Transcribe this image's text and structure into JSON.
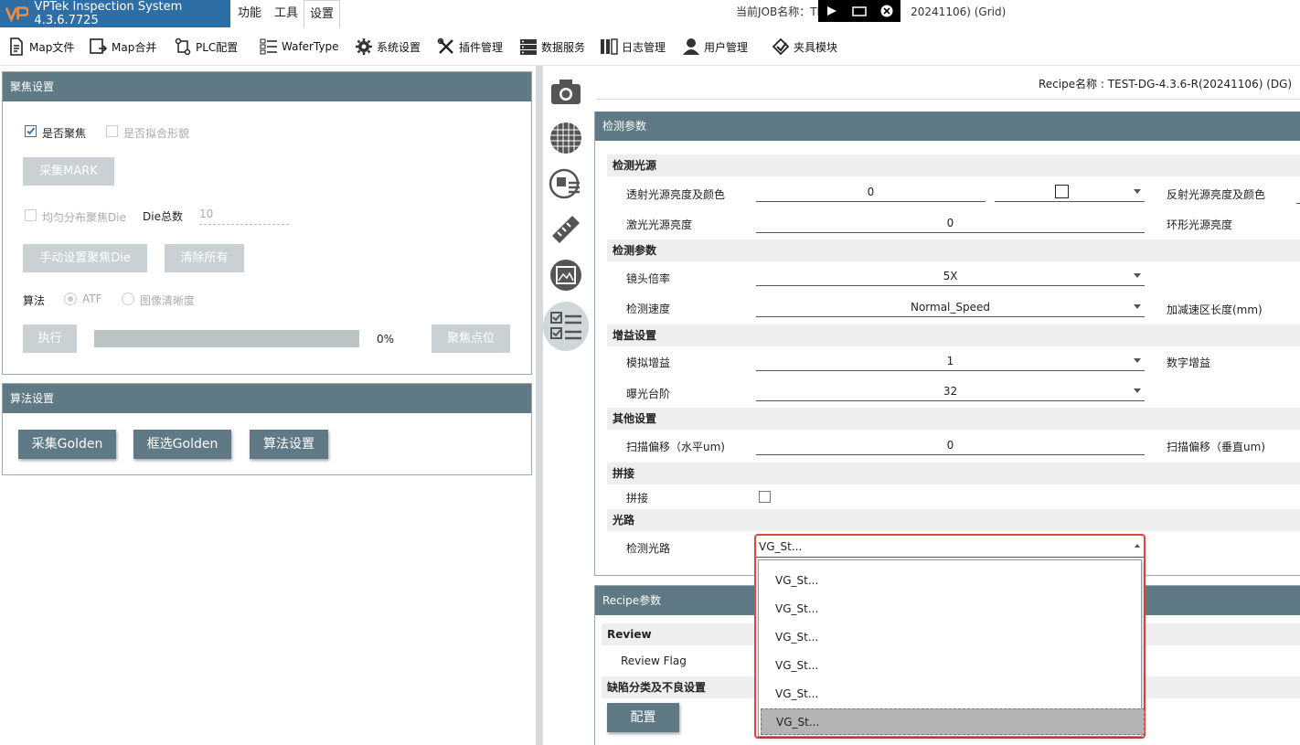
{
  "app": {
    "title": "VPTek Inspection System 4.3.6.7725",
    "menu": [
      "功能",
      "工具",
      "设置"
    ],
    "active_menu": "设置",
    "job_label": "当前JOB名称：TE",
    "job_suffix": "20241106) (Grid)"
  },
  "toolbar": [
    {
      "label": "Map文件",
      "icon": "document-icon"
    },
    {
      "label": "Map合并",
      "icon": "merge-icon"
    },
    {
      "label": "PLC配置",
      "icon": "plc-icon"
    },
    {
      "label": "WaferType",
      "icon": "list-icon"
    },
    {
      "label": "系统设置",
      "icon": "gear-icon"
    },
    {
      "label": "插件管理",
      "icon": "tools-icon"
    },
    {
      "label": "数据服务",
      "icon": "server-icon"
    },
    {
      "label": "日志管理",
      "icon": "log-icon"
    },
    {
      "label": "用户管理",
      "icon": "user-icon"
    },
    {
      "label": "夹具模块",
      "icon": "fixture-icon"
    }
  ],
  "focus_panel": {
    "title": "聚焦设置",
    "chk_focus": "是否聚焦",
    "chk_fit": "是否拟合形貌",
    "btn_mark": "采集MARK",
    "chk_uniform": "均匀分布聚焦Die",
    "die_total_label": "Die总数",
    "die_total_value": "10",
    "btn_manual": "手动设置聚焦Die",
    "btn_clear": "清除所有",
    "algo_label": "算法",
    "algo_atf": "ATF",
    "algo_image": "图像清晰度",
    "btn_exec": "执行",
    "progress_text": "0%",
    "progress": 0,
    "btn_focus_point": "聚焦点位"
  },
  "algo_panel": {
    "title": "算法设置",
    "btn_golden": "采集Golden",
    "btn_frame": "框选Golden",
    "btn_algo": "算法设置"
  },
  "recipe_name": "Recipe名称 : TEST-DG-4.3.6-R(20241106) (DG)",
  "detect": {
    "title": "检测参数",
    "groups": {
      "light": "检测光源",
      "params": "检测参数",
      "gain": "增益设置",
      "other": "其他设置",
      "stitch": "拼接",
      "optical": "光路"
    },
    "trans_label": "透射光源亮度及颜色",
    "trans_value": "0",
    "refl_label": "反射光源亮度及颜色",
    "laser_label": "激光光源亮度",
    "laser_value": "0",
    "ring_label": "环形光源亮度",
    "lens_label": "镜头倍率",
    "lens_value": "5X",
    "speed_label": "检测速度",
    "speed_value": "Normal_Speed",
    "accel_label": "加减速区长度(mm)",
    "analog_label": "模拟增益",
    "analog_value": "1",
    "digital_label": "数字增益",
    "exposure_label": "曝光台阶",
    "exposure_value": "32",
    "scan_h_label": "扫描偏移（水平um)",
    "scan_h_value": "0",
    "scan_v_label": "扫描偏移（垂直um)",
    "stitch_label": "拼接",
    "optical_label": "检测光路",
    "optical_value": "VG_St..."
  },
  "recipe_params": {
    "title": "Recipe参数",
    "review_group": "Review",
    "review_flag": "Review Flag",
    "defect_group": "缺陷分类及不良设置",
    "btn_config": "配置"
  },
  "dropdown_options": [
    "VG_St...",
    "VG_St...",
    "VG_St...",
    "VG_St...",
    "VG_St...",
    "VG_St..."
  ],
  "dropdown_selected_index": 5
}
